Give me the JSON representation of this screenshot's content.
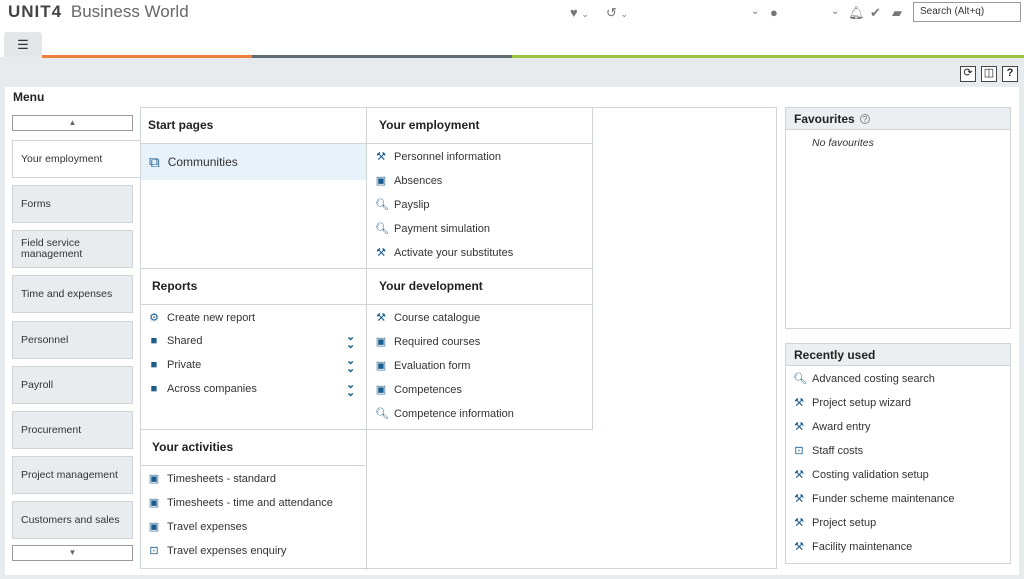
{
  "header": {
    "brand": "UNIT4",
    "product": "Business World",
    "search_placeholder": "Search (Alt+q)"
  },
  "colors": {
    "stripe_orange": "#f07f3c",
    "stripe_gray": "#5f6b73",
    "stripe_green": "#9ac23c",
    "accent": "#1b5c8e"
  },
  "menu": {
    "title": "Menu",
    "items": [
      "Your employment",
      "Forms",
      "Field service management",
      "Time and expenses",
      "Personnel",
      "Payroll",
      "Procurement",
      "Project management",
      "Customers and sales"
    ]
  },
  "sections": {
    "start_pages": {
      "title": "Start pages",
      "items": [
        "Communities"
      ]
    },
    "your_employment": {
      "title": "Your employment",
      "items": [
        "Personnel information",
        "Absences",
        "Payslip",
        "Payment simulation",
        "Activate your substitutes"
      ]
    },
    "reports": {
      "title": "Reports",
      "items": [
        "Create new report",
        "Shared",
        "Private",
        "Across companies"
      ]
    },
    "your_development": {
      "title": "Your development",
      "items": [
        "Course catalogue",
        "Required courses",
        "Evaluation form",
        "Competences",
        "Competence information"
      ]
    },
    "your_activities": {
      "title": "Your activities",
      "items": [
        "Timesheets - standard",
        "Timesheets - time and attendance",
        "Travel expenses",
        "Travel expenses enquiry"
      ]
    }
  },
  "favourites": {
    "title": "Favourites",
    "empty_text": "No favourites"
  },
  "recently_used": {
    "title": "Recently used",
    "items": [
      "Advanced costing search",
      "Project setup wizard",
      "Award entry",
      "Staff costs",
      "Costing validation setup",
      "Funder scheme maintenance",
      "Project setup",
      "Facility maintenance"
    ]
  }
}
